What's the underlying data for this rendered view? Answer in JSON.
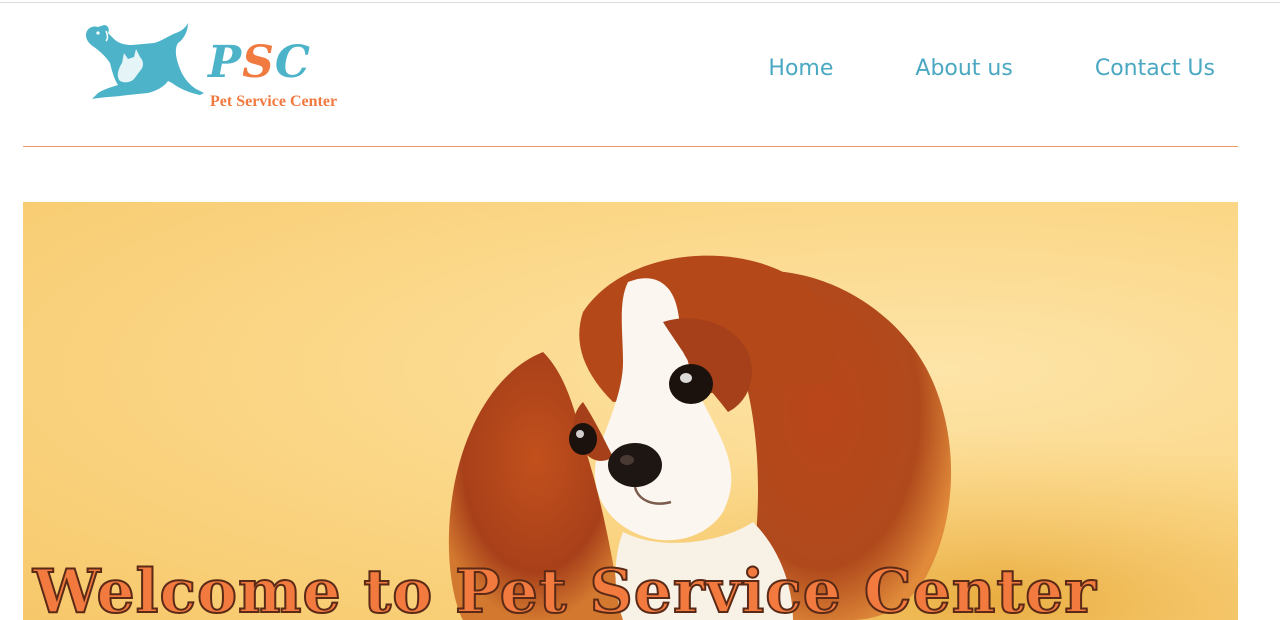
{
  "brand": {
    "abbr_p": "P",
    "abbr_s": "S",
    "abbr_c": "C",
    "name": "Pet Service Center",
    "logo_icon": "dog-cat-icon",
    "colors": {
      "teal": "#4cb3c9",
      "orange": "#f07a3f"
    }
  },
  "nav": {
    "items": [
      {
        "label": "Home"
      },
      {
        "label": "About us"
      },
      {
        "label": "Contact Us"
      }
    ]
  },
  "hero": {
    "title": "Welcome to Pet Service Center",
    "image": "cavalier-king-charles-puppy-photo",
    "background": "#fbd88a"
  }
}
